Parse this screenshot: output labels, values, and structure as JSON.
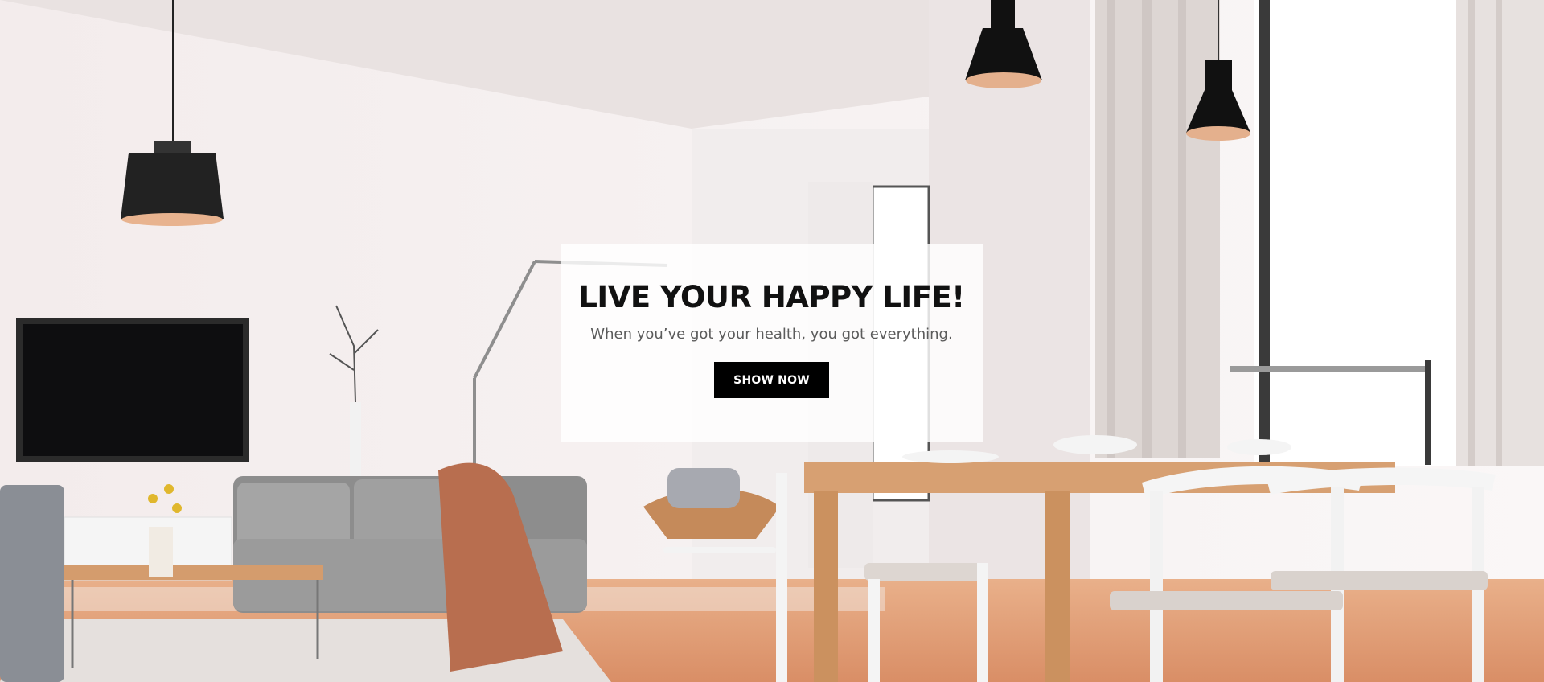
{
  "hero": {
    "title": "LIVE YOUR HAPPY LIFE!",
    "subtitle": "When you’ve got your health, you got everything.",
    "button_label": "SHOW NOW"
  },
  "colors": {
    "button_background": "#000000",
    "button_text": "#ffffff",
    "title_text": "#111111",
    "subtitle_text": "#5b5b5b"
  }
}
